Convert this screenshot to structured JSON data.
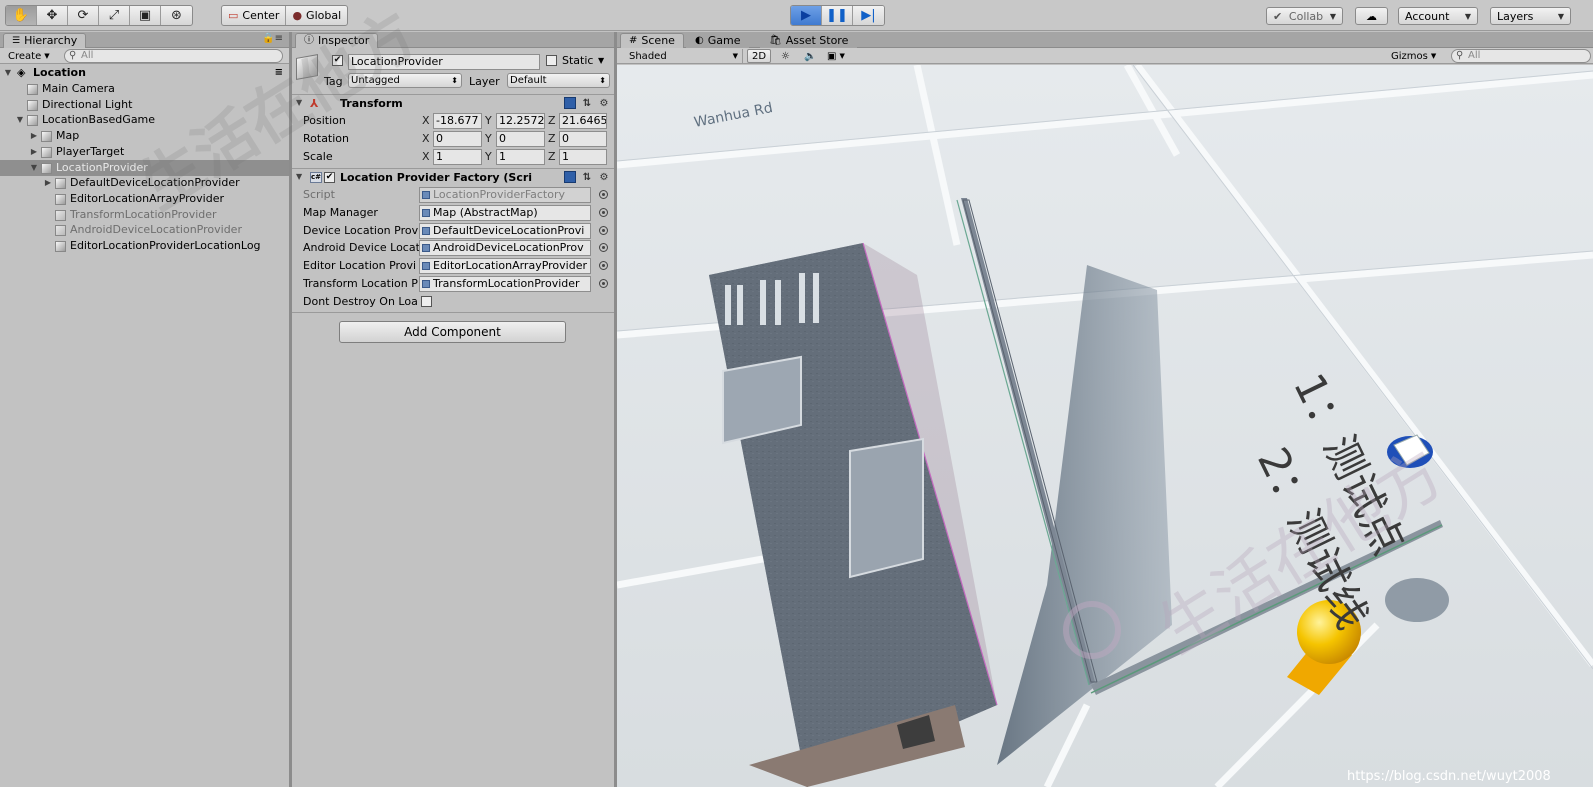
{
  "toolbar": {
    "transform_tools": [
      {
        "name": "hand-tool-icon",
        "glyph": "✋"
      },
      {
        "name": "move-tool-icon",
        "glyph": "✥"
      },
      {
        "name": "rotate-tool-icon",
        "glyph": "⟳"
      },
      {
        "name": "scale-tool-icon",
        "glyph": "⤢"
      },
      {
        "name": "rect-tool-icon",
        "glyph": "▣"
      },
      {
        "name": "transform-tool-icon",
        "glyph": "⊛"
      }
    ],
    "pivot_label": "Center",
    "space_label": "Global",
    "collab_label": "Collab",
    "account_label": "Account",
    "layers_label": "Layers"
  },
  "hierarchy": {
    "tab_label": "Hierarchy",
    "create_label": "Create",
    "search_placeholder": "All",
    "scene_name": "Location",
    "items": [
      {
        "label": "Main Camera",
        "depth": 1,
        "fold": ""
      },
      {
        "label": "Directional Light",
        "depth": 1,
        "fold": ""
      },
      {
        "label": "LocationBasedGame",
        "depth": 1,
        "fold": "open"
      },
      {
        "label": "Map",
        "depth": 2,
        "fold": "closed"
      },
      {
        "label": "PlayerTarget",
        "depth": 2,
        "fold": "closed"
      },
      {
        "label": "LocationProvider",
        "depth": 2,
        "fold": "open",
        "selected": true
      },
      {
        "label": "DefaultDeviceLocationProvider",
        "depth": 3,
        "fold": "closed"
      },
      {
        "label": "EditorLocationArrayProvider",
        "depth": 3,
        "fold": ""
      },
      {
        "label": "TransformLocationProvider",
        "depth": 3,
        "fold": "",
        "disabled": true
      },
      {
        "label": "AndroidDeviceLocationProvider",
        "depth": 3,
        "fold": "",
        "disabled": true
      },
      {
        "label": "EditorLocationProviderLocationLog",
        "depth": 3,
        "fold": ""
      }
    ]
  },
  "inspector": {
    "tab_label": "Inspector",
    "object_name": "LocationProvider",
    "static_label": "Static",
    "tag_label": "Tag",
    "tag_value": "Untagged",
    "layer_label": "Layer",
    "layer_value": "Default",
    "transform": {
      "title": "Transform",
      "position_label": "Position",
      "rotation_label": "Rotation",
      "scale_label": "Scale",
      "position": {
        "x": "-18.677",
        "y": "12.2572",
        "z": "21.6465"
      },
      "rotation": {
        "x": "0",
        "y": "0",
        "z": "0"
      },
      "scale": {
        "x": "1",
        "y": "1",
        "z": "1"
      }
    },
    "factory": {
      "title": "Location Provider Factory (Scri",
      "fields": [
        {
          "label": "Script",
          "value": "LocationProviderFactory",
          "disabled": true
        },
        {
          "label": "Map Manager",
          "value": "Map (AbstractMap)"
        },
        {
          "label": "Device Location Prov",
          "value": "DefaultDeviceLocationProvi"
        },
        {
          "label": "Android Device Location Prov",
          "value": "AndroidDeviceLocationProv"
        },
        {
          "label": "Editor Location Provi",
          "value": "EditorLocationArrayProvider"
        },
        {
          "label": "Transform Location P",
          "value": "TransformLocationProvider"
        }
      ],
      "dont_destroy_label": "Dont Destroy On Loa"
    },
    "add_component_label": "Add Component"
  },
  "scene": {
    "tabs": [
      {
        "label": "Scene",
        "icon": "#"
      },
      {
        "label": "Game",
        "icon": "◐"
      },
      {
        "label": "Asset Store",
        "icon": "🛍"
      }
    ],
    "shading_label": "Shaded",
    "mode_2d_label": "2D",
    "gizmos_label": "Gizmos",
    "search_placeholder": "All",
    "road_label": "Wanhua Rd",
    "text_line_1": "1：测试点",
    "text_line_2": "2：测试线",
    "watermark_text": "生活在他方",
    "credit_text": "https://blog.csdn.net/wuyt2008"
  },
  "colors": {
    "editor_bg": "#c2c2c2",
    "selection": "#8f8f8f",
    "play_blue": "#1060c8",
    "ground": "#dfe4e7",
    "road_line": "#f6f8f9",
    "building": "#5e6a78",
    "player_yellow": "#f5b400"
  }
}
